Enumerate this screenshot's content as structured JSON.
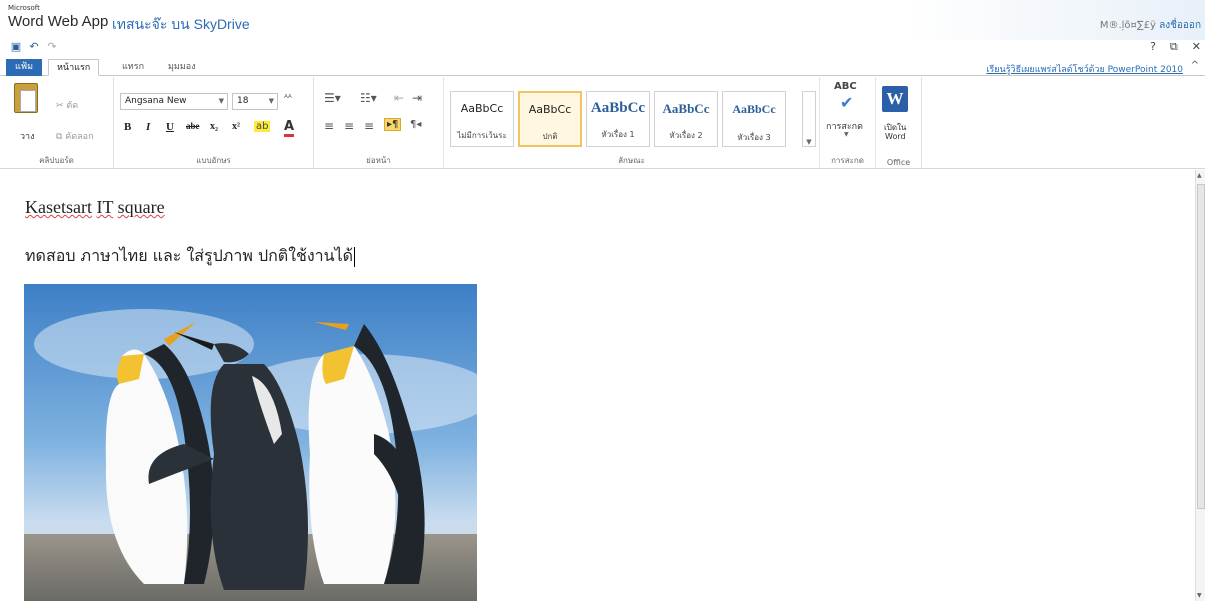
{
  "header": {
    "brand_small": "Microsoft",
    "brand": "Word Web App",
    "doc_title": "เทสนะจ๊ะ บน SkyDrive",
    "user": "M®.ļõ¤∑£ÿ",
    "signout": "ลงชื่อออก"
  },
  "top_icons": {
    "help": "?",
    "restore": "⧉",
    "close": "✕"
  },
  "qat": {
    "save": "▣",
    "undo": "↶",
    "redo": "↷"
  },
  "tabs": {
    "file": "แฟ้ม",
    "home": "หน้าแรก",
    "insert": "แทรก",
    "view": "มุมมอง"
  },
  "ppt_link": "เรียนรู้วิธีเผยแพร่สไลด์โชว์ด้วย PowerPoint 2010",
  "collapse_icon": "^",
  "ribbon": {
    "clipboard": {
      "paste": "วาง",
      "cut": "ตัด",
      "copy": "คัดลอก",
      "label": "คลิปบอร์ด"
    },
    "font": {
      "name": "Angsana New",
      "size": "18",
      "bold": "B",
      "italic": "I",
      "underline": "U",
      "strike": "abe",
      "subscript": "x₂",
      "superscript": "x²",
      "label": "แบบอักษร"
    },
    "paragraph": {
      "label": "ย่อหน้า"
    },
    "styles": {
      "items": [
        {
          "sample": "AaBbCc",
          "name": "ไม่มีการเว้นระ"
        },
        {
          "sample": "AaBbCc",
          "name": "ปกติ"
        },
        {
          "sample": "AaBbCc",
          "name": "หัวเรื่อง 1"
        },
        {
          "sample": "AaBbCc",
          "name": "หัวเรื่อง 2"
        },
        {
          "sample": "AaBbCc",
          "name": "หัวเรื่อง 3"
        }
      ],
      "label": "ลักษณะ"
    },
    "spelling": {
      "icon_text": "ABC",
      "button": "การสะกด",
      "label": "การสะกด"
    },
    "office": {
      "open_line1": "เปิดใน",
      "open_line2": "Word",
      "label": "Office"
    }
  },
  "document": {
    "line1": "Kasetsart IT square",
    "line1_words": [
      "Kasetsart",
      "IT",
      "square"
    ],
    "line2": "ทดสอบ ภาษาไทย และ ใส่รูปภาพ  ปกติใช้งานได้"
  },
  "colors": {
    "accent": "#2b6cb5",
    "selected_style": "#f0c460"
  }
}
